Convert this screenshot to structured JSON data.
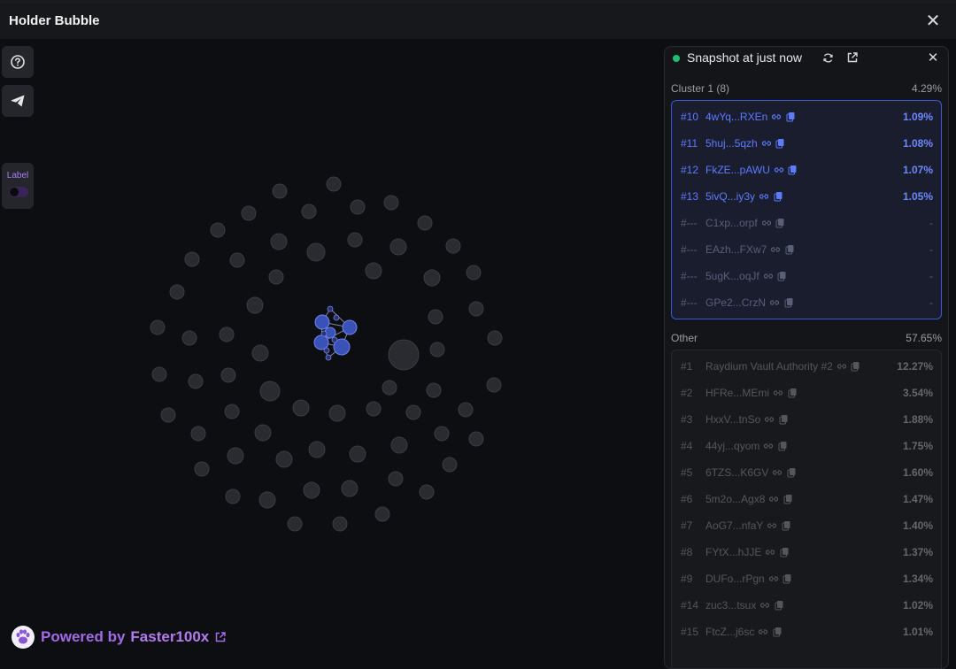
{
  "window": {
    "title": "Holder Bubble"
  },
  "toolbar": {
    "label_toggle_text": "Label"
  },
  "footer": {
    "powered_by": "Powered by",
    "brand": "Faster100x"
  },
  "panel": {
    "snapshot_text": "Snapshot at just now",
    "cluster": {
      "label": "Cluster 1 (8)",
      "pct": "4.29%",
      "rows": [
        {
          "rank": "#10",
          "addr": "4wYq...RXEn",
          "val": "1.09%",
          "state": "active"
        },
        {
          "rank": "#11",
          "addr": "5huj...5qzh",
          "val": "1.08%",
          "state": "active"
        },
        {
          "rank": "#12",
          "addr": "FkZE...pAWU",
          "val": "1.07%",
          "state": "active"
        },
        {
          "rank": "#13",
          "addr": "5ivQ...iy3y",
          "val": "1.05%",
          "state": "active"
        },
        {
          "rank": "#---",
          "addr": "C1xp...orpf",
          "val": "-",
          "state": "inactive"
        },
        {
          "rank": "#---",
          "addr": "EAzh...FXw7",
          "val": "-",
          "state": "inactive"
        },
        {
          "rank": "#---",
          "addr": "5ugK...oqJf",
          "val": "-",
          "state": "inactive"
        },
        {
          "rank": "#---",
          "addr": "GPe2...CrzN",
          "val": "-",
          "state": "inactive"
        }
      ]
    },
    "other": {
      "label": "Other",
      "pct": "57.65%",
      "rows": [
        {
          "rank": "#1",
          "addr": "Raydium Vault Authority #2",
          "val": "12.27%"
        },
        {
          "rank": "#2",
          "addr": "HFRe...MEmi",
          "val": "3.54%"
        },
        {
          "rank": "#3",
          "addr": "HxxV...tnSo",
          "val": "1.88%"
        },
        {
          "rank": "#4",
          "addr": "44yj...qyom",
          "val": "1.75%"
        },
        {
          "rank": "#5",
          "addr": "6TZS...K6GV",
          "val": "1.60%"
        },
        {
          "rank": "#6",
          "addr": "5m2o...Agx8",
          "val": "1.47%"
        },
        {
          "rank": "#7",
          "addr": "AoG7...nfaY",
          "val": "1.40%"
        },
        {
          "rank": "#8",
          "addr": "FYtX...hJJE",
          "val": "1.37%"
        },
        {
          "rank": "#9",
          "addr": "DUFo...rPgn",
          "val": "1.34%"
        },
        {
          "rank": "#14",
          "addr": "zuc3...tsux",
          "val": "1.02%"
        },
        {
          "rank": "#15",
          "addr": "FtcZ...j6sc",
          "val": "1.01%"
        }
      ]
    }
  },
  "colors": {
    "accent_purple": "#a46ae6",
    "cluster_blue": "#3d5ad6",
    "status_green": "#1fbf73",
    "background": "#0d0e11"
  }
}
